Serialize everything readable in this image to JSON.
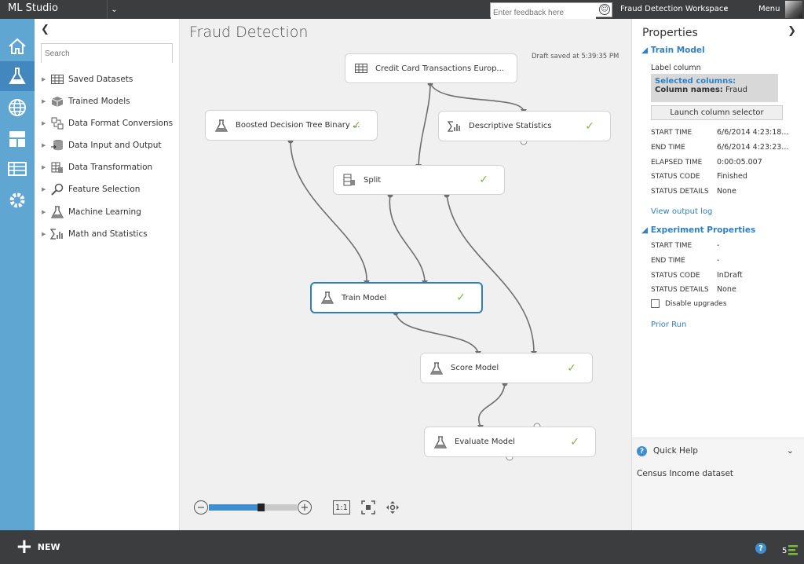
{
  "app": {
    "title": "ML Studio"
  },
  "top": {
    "feedback_placeholder": "Enter feedback here",
    "workspace": "Fraud Detection Workspace",
    "menu": "Menu"
  },
  "nav": [
    "home-icon",
    "experiments-icon",
    "web-services-icon",
    "dashboard-icon",
    "datasets-icon",
    "settings-icon"
  ],
  "palette": {
    "search_placeholder": "Search",
    "items": [
      {
        "label": "Saved Datasets",
        "icon": "table-icon"
      },
      {
        "label": "Trained Models",
        "icon": "cube-icon"
      },
      {
        "label": "Data Format Conversions",
        "icon": "convert-icon"
      },
      {
        "label": "Data Input and Output",
        "icon": "database-icon"
      },
      {
        "label": "Data Transformation",
        "icon": "transform-icon"
      },
      {
        "label": "Feature Selection",
        "icon": "magnifier-icon"
      },
      {
        "label": "Machine Learning",
        "icon": "flask-icon"
      },
      {
        "label": "Math and Statistics",
        "icon": "sigma-icon"
      }
    ]
  },
  "experiment": {
    "title": "Fraud Detection",
    "draft_status": "Draft saved at 5:39:35 PM",
    "modules": {
      "credit_card": "Credit Card Transactions Europ...",
      "boosted_tree": "Boosted Decision Tree Binary ...",
      "descriptive_stats": "Descriptive Statistics",
      "split": "Split",
      "train_model": "Train Model",
      "score_model": "Score Model",
      "evaluate_model": "Evaluate Model"
    },
    "check_mark": "✓",
    "zoom_percent": 55,
    "zoom_actual": "1:1"
  },
  "properties": {
    "title": "Properties",
    "module_section": "Train Model",
    "label_column_caption": "Label column",
    "selected_columns_title": "Selected columns:",
    "column_names_label": "Column names:",
    "column_names_value": "Fraud",
    "launch_button": "Launch column selector",
    "run_rows": [
      {
        "label": "START TIME",
        "value": "6/6/2014 4:23:18..."
      },
      {
        "label": "END TIME",
        "value": "6/6/2014 4:23:23..."
      },
      {
        "label": "ELAPSED TIME",
        "value": "0:00:05.007"
      },
      {
        "label": "STATUS CODE",
        "value": "Finished"
      },
      {
        "label": "STATUS DETAILS",
        "value": "None"
      }
    ],
    "view_output_log": "View output log",
    "experiment_section": "Experiment Properties",
    "exp_rows": [
      {
        "label": "START TIME",
        "value": "-"
      },
      {
        "label": "END TIME",
        "value": "-"
      },
      {
        "label": "STATUS CODE",
        "value": "InDraft"
      },
      {
        "label": "STATUS DETAILS",
        "value": "None"
      }
    ],
    "disable_upgrades": "Disable upgrades",
    "prior_run": "Prior Run"
  },
  "quick_help": {
    "title": "Quick Help",
    "text": "Census Income dataset"
  },
  "bottom": {
    "new_label": "NEW",
    "notifications": "5",
    "help": "?"
  },
  "colors": {
    "accent": "#2f80c4",
    "nav_bg": "#5fa6d3",
    "dark_bar": "#3c3d3e",
    "check_green": "#7ab93c"
  }
}
